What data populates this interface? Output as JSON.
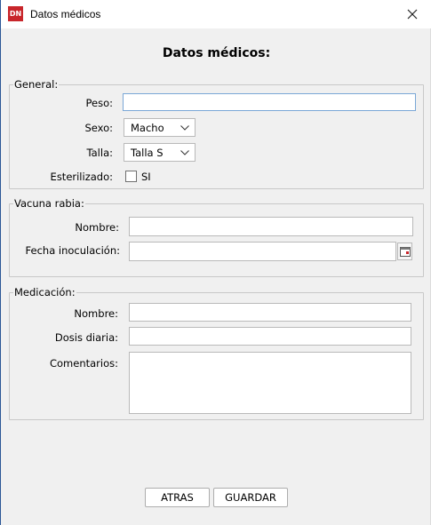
{
  "window": {
    "title": "Datos médicos",
    "app_icon_text": "DN",
    "close_icon": "close-icon"
  },
  "heading": "Datos médicos:",
  "general": {
    "legend": "General:",
    "peso_label": "Peso:",
    "peso_value": "",
    "sexo_label": "Sexo:",
    "sexo_value": "Macho",
    "talla_label": "Talla:",
    "talla_value": "Talla S",
    "esterilizado_label": "Esterilizado:",
    "esterilizado_option": "SI",
    "esterilizado_checked": false
  },
  "vacuna": {
    "legend": "Vacuna rabia:",
    "nombre_label": "Nombre:",
    "nombre_value": "",
    "fecha_label": "Fecha inoculación:",
    "fecha_value": "",
    "calendar_icon": "calendar-icon"
  },
  "medicacion": {
    "legend": "Medicación:",
    "nombre_label": "Nombre:",
    "nombre_value": "",
    "dosis_label": "Dosis diaria:",
    "dosis_value": "",
    "comentarios_label": "Comentarios:",
    "comentarios_value": ""
  },
  "buttons": {
    "atras": "ATRAS",
    "guardar": "GUARDAR"
  },
  "colors": {
    "app_icon_bg": "#c8262b",
    "focus_border": "#7aa7d6",
    "window_bg": "#f0f0f0"
  }
}
